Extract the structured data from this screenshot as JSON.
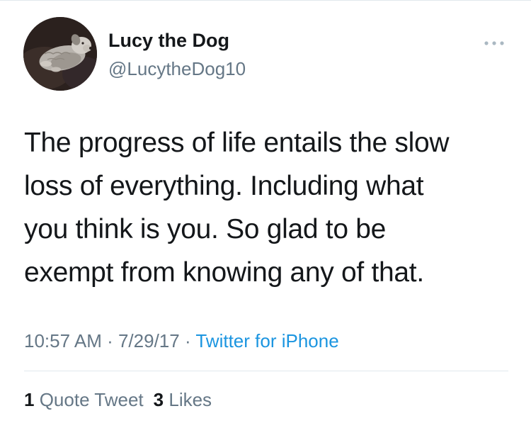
{
  "author": {
    "name": "Lucy the Dog",
    "handle": "@LucytheDog10"
  },
  "tweet": {
    "lines": [
      "The progress of life entails the slow",
      "loss of everything. Including what",
      "you think is you. So glad to be",
      "exempt from knowing any of that."
    ]
  },
  "meta": {
    "time": "10:57 AM",
    "separator": " · ",
    "date": "7/29/17",
    "source": "Twitter for iPhone"
  },
  "stats": {
    "quote_count": "1",
    "quote_label": "Quote Tweet",
    "like_count": "3",
    "like_label": "Likes"
  },
  "icons": {
    "more": "more-dots-icon"
  },
  "colors": {
    "text": "#14171a",
    "secondary": "#657786",
    "link": "#1b95e0",
    "divider": "#e1e8ed"
  }
}
